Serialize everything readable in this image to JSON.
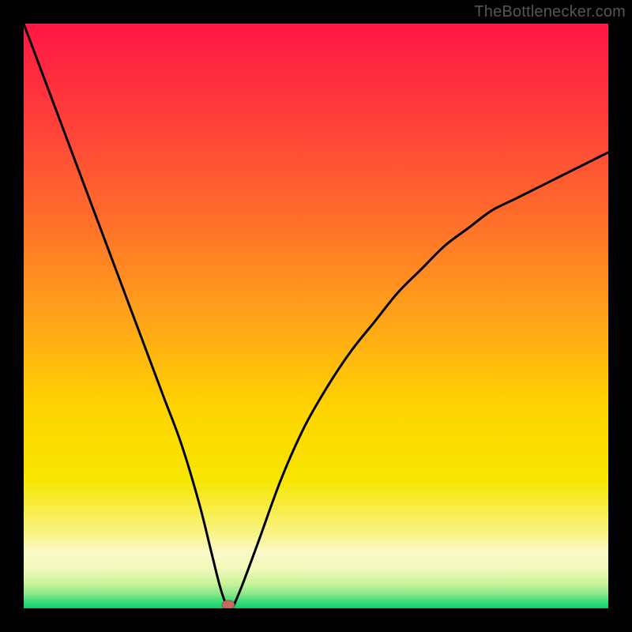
{
  "watermark": "TheBottlenecker.com",
  "chart_data": {
    "type": "line",
    "title": "",
    "xlabel": "",
    "ylabel": "",
    "xlim": [
      0,
      100
    ],
    "ylim": [
      0,
      100
    ],
    "grid": false,
    "legend": false,
    "series": [
      {
        "name": "bottleneck-curve",
        "x": [
          0,
          3,
          6,
          9,
          12,
          15,
          18,
          21,
          24,
          27,
          30,
          32,
          33.5,
          34.5,
          35.5,
          37,
          40,
          44,
          48,
          52,
          56,
          60,
          64,
          68,
          72,
          76,
          80,
          84,
          88,
          92,
          96,
          100
        ],
        "y": [
          100,
          92,
          84,
          76,
          68,
          60,
          52,
          44,
          36,
          28,
          18,
          10,
          4,
          1,
          0,
          3,
          11,
          22,
          31,
          38,
          44,
          49,
          54,
          58,
          62,
          65,
          68,
          70,
          72,
          74,
          76,
          78
        ]
      }
    ],
    "marker": {
      "x": 35,
      "y": 0.6,
      "color": "#c46a5c"
    },
    "background": {
      "type": "vertical-gradient",
      "stops": [
        {
          "pos": 0.0,
          "color": "#ff1744"
        },
        {
          "pos": 0.15,
          "color": "#ff3b3b"
        },
        {
          "pos": 0.32,
          "color": "#ff6a2c"
        },
        {
          "pos": 0.5,
          "color": "#ffa31a"
        },
        {
          "pos": 0.66,
          "color": "#ffd400"
        },
        {
          "pos": 0.78,
          "color": "#f6e600"
        },
        {
          "pos": 0.865,
          "color": "#f8f27a"
        },
        {
          "pos": 0.905,
          "color": "#fbfac8"
        },
        {
          "pos": 0.935,
          "color": "#eef9b8"
        },
        {
          "pos": 0.958,
          "color": "#c8f39a"
        },
        {
          "pos": 0.975,
          "color": "#8de88a"
        },
        {
          "pos": 0.988,
          "color": "#3fdc7a"
        },
        {
          "pos": 1.0,
          "color": "#16c96b"
        }
      ]
    }
  }
}
